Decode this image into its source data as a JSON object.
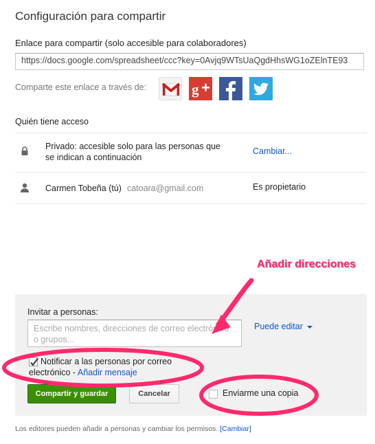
{
  "dialog": {
    "title": "Configuración para compartir"
  },
  "share_link": {
    "label": "Enlace para compartir (solo accesible para colaboradores)",
    "value": "https://docs.google.com/spreadsheet/ccc?key=0Avjq9WTsUaQgdHhsWG1oZElnTE93"
  },
  "share_via": {
    "label": "Comparte este enlace a través de:",
    "icons": [
      "gmail-icon",
      "google-plus-icon",
      "facebook-icon",
      "twitter-icon"
    ],
    "colors": {
      "gplus": "#d73d32",
      "facebook": "#3b5998",
      "twitter": "#2fa9e0",
      "gmail_red": "#c5221f"
    }
  },
  "access": {
    "header": "Quién tiene acceso",
    "rows": [
      {
        "icon": "lock-icon",
        "text": "Privado: accesible solo para las personas que se indican a continuación",
        "action": "Cambiar..."
      },
      {
        "icon": "person-icon",
        "name": "Carmen Tobeña (tú)",
        "email": "catoara@gmail.com",
        "role": "Es propietario"
      }
    ]
  },
  "annotation": {
    "label": "Añadir direcciones",
    "color": "#ff2a6d"
  },
  "invite": {
    "label": "Invitar a personas:",
    "placeholder": "Escribe nombres, direcciones de correo electrónico o grupos...",
    "permission": "Puede editar",
    "notify_label": "Notificar a las personas por correo electrónico",
    "notify_separator": " - ",
    "notify_checked": true,
    "add_message": "Añadir mensaje",
    "save_button": "Compartir y guardar",
    "cancel_button": "Cancelar",
    "copy_label": "Enviarme una copia",
    "copy_checked": false
  },
  "footer": {
    "text": "Los editores pueden añadir a personas y cambiar los permisos.",
    "change_link": "[Cambiar]"
  }
}
